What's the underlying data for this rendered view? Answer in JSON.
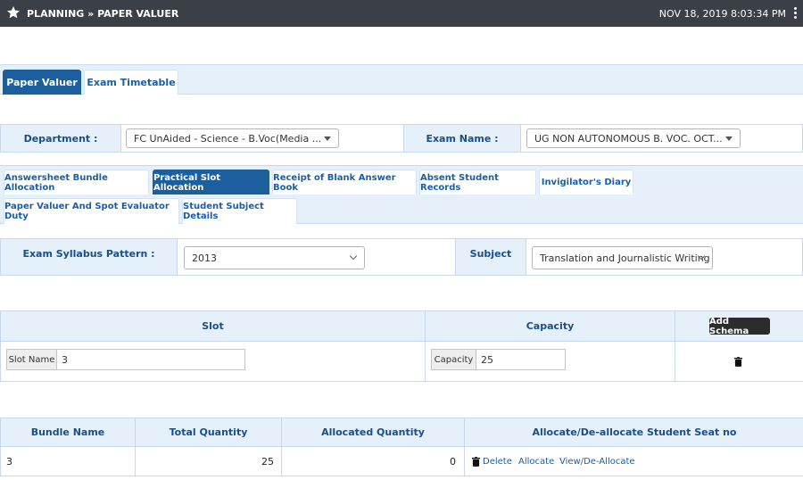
{
  "header": {
    "title": "PLANNING » PAPER VALUER",
    "datetime": "NOV 18, 2019  8:03:34 PM",
    "icons": {
      "star": "star-icon",
      "menu": "kebab-menu-icon"
    }
  },
  "main_tabs": [
    {
      "label": "Paper Valuer",
      "active": true
    },
    {
      "label": "Exam Timetable",
      "active": false
    }
  ],
  "filters": {
    "department_label": "Department :",
    "department_value": "FC UnAided - Science - B.Voc(Media ...",
    "exam_name_label": "Exam Name :",
    "exam_name_value": "UG NON AUTONOMOUS B. VOC. OCT..."
  },
  "sub_tabs": [
    {
      "label": "Answersheet Bundle Allocation",
      "active": false
    },
    {
      "label": "Practical Slot Allocation",
      "active": true
    },
    {
      "label": "Receipt of Blank Answer Book",
      "active": false
    },
    {
      "label": "Absent Student Records",
      "active": false
    },
    {
      "label": "Invigilator's Diary",
      "active": false
    },
    {
      "label": "Paper Valuer And Spot Evaluator Duty",
      "active": false
    },
    {
      "label": "Student Subject Details",
      "active": false
    }
  ],
  "syllabus": {
    "pattern_label": "Exam Syllabus Pattern :",
    "pattern_value": "2013",
    "subject_label": "Subject",
    "subject_value": "Translation and Journalistic Writing"
  },
  "slot_table": {
    "headers": {
      "slot": "Slot",
      "capacity": "Capacity"
    },
    "add_schema_label": "Add Schema",
    "slot_name_addon": "Slot Name",
    "slot_name_value": "3",
    "capacity_addon": "Capacity",
    "capacity_value": "25"
  },
  "bundle_table": {
    "headers": [
      "Bundle Name",
      "Total Quantity",
      "Allocated Quantity",
      "Allocate/De-allocate Student Seat no"
    ],
    "rows": [
      {
        "bundle_name": "3",
        "total_quantity": "25",
        "allocated_quantity": "0"
      }
    ],
    "actions": {
      "delete": "Delete",
      "allocate": "Allocate",
      "view": "View/De-Allocate"
    }
  },
  "colors": {
    "topbar": "#3b3f46",
    "accent": "#1b5f9e",
    "band": "#e6f0fb",
    "link": "#1a5ea8"
  }
}
